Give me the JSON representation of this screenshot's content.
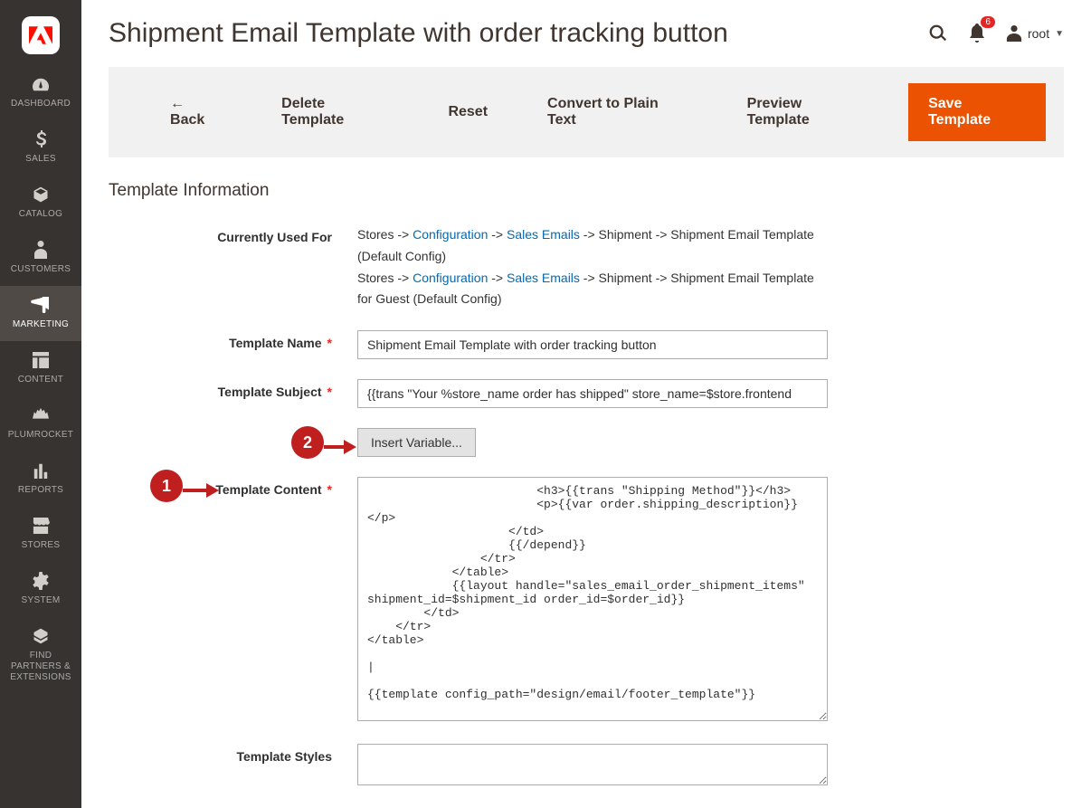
{
  "header": {
    "title": "Shipment Email Template with order tracking button",
    "notification_count": "6",
    "user_name": "root"
  },
  "sidebar": {
    "items": [
      {
        "label": "DASHBOARD"
      },
      {
        "label": "SALES"
      },
      {
        "label": "CATALOG"
      },
      {
        "label": "CUSTOMERS"
      },
      {
        "label": "MARKETING"
      },
      {
        "label": "CONTENT"
      },
      {
        "label": "PLUMROCKET"
      },
      {
        "label": "REPORTS"
      },
      {
        "label": "STORES"
      },
      {
        "label": "SYSTEM"
      },
      {
        "label": "FIND PARTNERS & EXTENSIONS"
      }
    ]
  },
  "toolbar": {
    "back": "Back",
    "delete": "Delete Template",
    "reset": "Reset",
    "convert": "Convert to Plain Text",
    "preview": "Preview Template",
    "save": "Save Template"
  },
  "section_title": "Template Information",
  "form": {
    "used_for_label": "Currently Used For",
    "used_for": {
      "prefix": "Stores -> ",
      "link1": "Configuration",
      "sep": " -> ",
      "link2": "Sales Emails",
      "suffix1": " -> Shipment -> Shipment Email Template  (Default Config)",
      "suffix2": " -> Shipment -> Shipment Email Template for Guest  (Default Config)"
    },
    "name_label": "Template Name",
    "name_value": "Shipment Email Template with order tracking button",
    "subject_label": "Template Subject",
    "subject_value": "{{trans \"Your %store_name order has shipped\" store_name=$store.frontend",
    "insert_variable_label": "Insert Variable...",
    "content_label": "Template Content",
    "content_value": "                        <h3>{{trans \"Shipping Method\"}}</h3>\n                        <p>{{var order.shipping_description}}</p>\n                    </td>\n                    {{/depend}}\n                </tr>\n            </table>\n            {{layout handle=\"sales_email_order_shipment_items\" shipment_id=$shipment_id order_id=$order_id}}\n        </td>\n    </tr>\n</table>\n\n|\n\n{{template config_path=\"design/email/footer_template\"}}",
    "styles_label": "Template Styles"
  },
  "annotations": {
    "one": "1",
    "two": "2"
  }
}
